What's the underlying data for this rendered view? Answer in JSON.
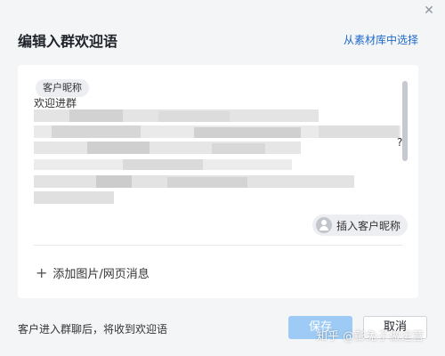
{
  "dialog": {
    "title": "编辑入群欢迎语",
    "top_link": "从素材库中选择",
    "close_icon": "close-icon"
  },
  "editor": {
    "tag_label": "客户昵称",
    "content_fragment": "欢迎进群",
    "question_mark": "?",
    "insert_button": "插入客户昵称",
    "add_media": "添加图片/网页消息",
    "add_media_icon": "plus-icon"
  },
  "footer": {
    "hint": "客户进入群聊后，将收到欢迎语",
    "save_label": "保存",
    "cancel_label": "取消"
  },
  "watermark": "知乎 @彭兔子做运营",
  "colors": {
    "accent": "#1f69c9",
    "save_button": "#9ecbf5"
  }
}
